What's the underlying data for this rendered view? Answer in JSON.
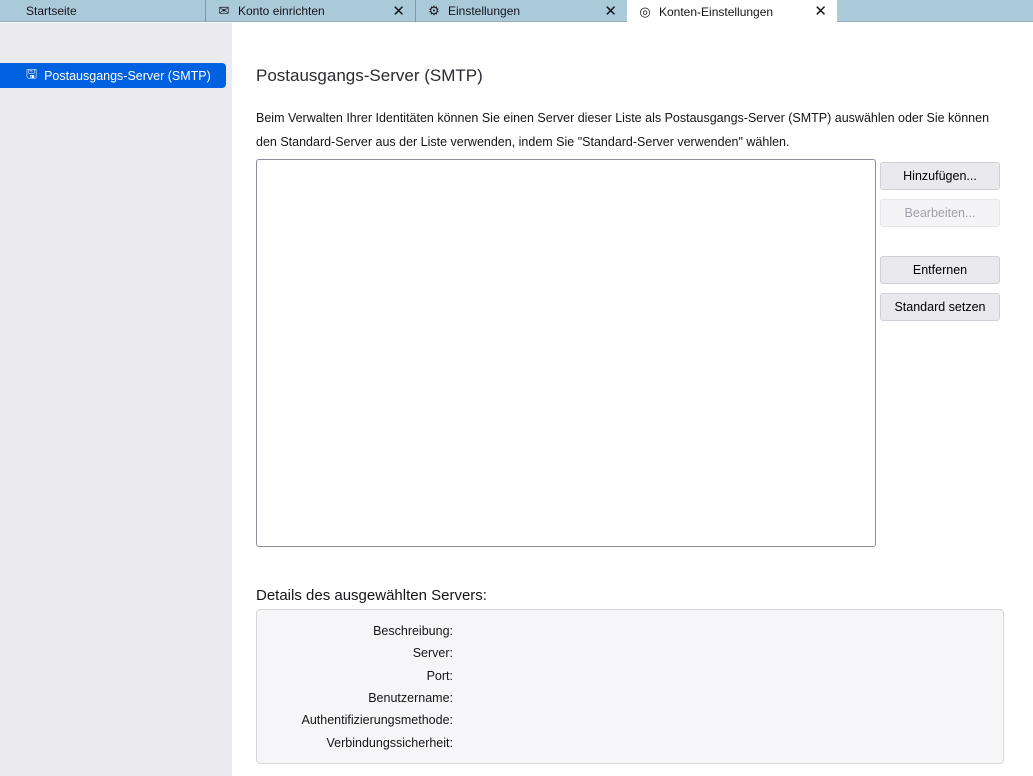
{
  "tabs": [
    {
      "label": "Startseite",
      "icon": ""
    },
    {
      "label": "Konto einrichten",
      "icon": "mail-icon",
      "close": "✕"
    },
    {
      "label": "Einstellungen",
      "icon": "gear-icon",
      "close": "✕"
    },
    {
      "label": "Konten-Einstellungen",
      "icon": "account-icon",
      "close": "✕",
      "active": true
    }
  ],
  "sidebar": {
    "items": [
      {
        "label": "Postausgangs-Server (SMTP)",
        "selected": true
      }
    ]
  },
  "main": {
    "title": "Postausgangs-Server (SMTP)",
    "description": "Beim Verwalten Ihrer Identitäten können Sie einen Server dieser Liste als Postausgangs-Server (SMTP) auswählen oder Sie können den Standard-Server aus der Liste verwenden, indem Sie \"Standard-Server verwenden\" wählen.",
    "buttons": {
      "add": "Hinzufügen...",
      "edit": "Bearbeiten...",
      "remove": "Entfernen",
      "set_default": "Standard setzen"
    },
    "details": {
      "heading": "Details des ausgewählten Servers:",
      "labels": [
        "Beschreibung:",
        "Server:",
        "Port:",
        "Benutzername:",
        "Authentifizierungsmethode:",
        "Verbindungssicherheit:"
      ]
    }
  }
}
